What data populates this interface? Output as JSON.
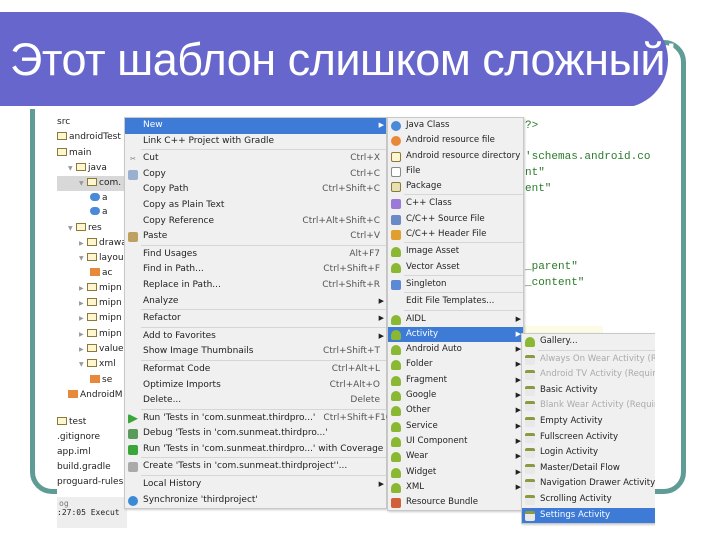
{
  "slide": {
    "title": "Этот шаблон слишком сложный!",
    "banner_color": "#6666cc",
    "frame_color": "#5f9c96"
  },
  "tree": {
    "items": [
      {
        "label": "src",
        "indent": 0,
        "icon": "none"
      },
      {
        "label": "androidTest",
        "indent": 0,
        "icon": "folder-icon"
      },
      {
        "label": "main",
        "indent": 0,
        "icon": "folder-icon"
      },
      {
        "label": "java",
        "indent": 1,
        "icon": "folder-icon",
        "open": true
      },
      {
        "label": "com.",
        "indent": 2,
        "icon": "package-icon",
        "open": true,
        "selected": true
      },
      {
        "label": "a",
        "indent": 3,
        "icon": "class-icon"
      },
      {
        "label": "a",
        "indent": 3,
        "icon": "class-icon"
      },
      {
        "label": "res",
        "indent": 1,
        "icon": "res-folder-icon",
        "open": true
      },
      {
        "label": "drawa",
        "indent": 2,
        "icon": "folder-icon",
        "closed": true
      },
      {
        "label": "layou",
        "indent": 2,
        "icon": "folder-icon",
        "open": true
      },
      {
        "label": "ac",
        "indent": 3,
        "icon": "layout-file-icon"
      },
      {
        "label": "mipn",
        "indent": 2,
        "icon": "folder-icon",
        "closed": true
      },
      {
        "label": "mipn",
        "indent": 2,
        "icon": "folder-icon",
        "closed": true
      },
      {
        "label": "mipn",
        "indent": 2,
        "icon": "folder-icon",
        "closed": true
      },
      {
        "label": "mipn",
        "indent": 2,
        "icon": "folder-icon",
        "closed": true
      },
      {
        "label": "value",
        "indent": 2,
        "icon": "folder-icon",
        "closed": true
      },
      {
        "label": "xml",
        "indent": 2,
        "icon": "folder-icon",
        "open": true
      },
      {
        "label": "se",
        "indent": 3,
        "icon": "xml-file-icon"
      },
      {
        "label": "AndroidM",
        "indent": 1,
        "icon": "manifest-icon"
      },
      {
        "label": "test",
        "indent": 0,
        "icon": "folder-icon"
      },
      {
        "label": ".gitignore",
        "indent": 0,
        "icon": "none"
      },
      {
        "label": "app.iml",
        "indent": 0,
        "icon": "none"
      },
      {
        "label": "build.gradle",
        "indent": 0,
        "icon": "none"
      },
      {
        "label": "proguard-rules.p",
        "indent": 0,
        "icon": "none"
      }
    ],
    "log_title": "og",
    "log_line": ":27:05 Execut"
  },
  "context_menu": [
    {
      "label": "New",
      "submenu": true,
      "highlight": true
    },
    {
      "label": "Link C++ Project with Gradle"
    },
    {
      "sep": true
    },
    {
      "label": "Cut",
      "shortcut": "Ctrl+X",
      "icon": "scissors-icon"
    },
    {
      "label": "Copy",
      "shortcut": "Ctrl+C",
      "icon": "copy-icon"
    },
    {
      "label": "Copy Path",
      "shortcut": "Ctrl+Shift+C"
    },
    {
      "label": "Copy as Plain Text"
    },
    {
      "label": "Copy Reference",
      "shortcut": "Ctrl+Alt+Shift+C"
    },
    {
      "label": "Paste",
      "shortcut": "Ctrl+V",
      "icon": "paste-icon"
    },
    {
      "sep": true
    },
    {
      "label": "Find Usages",
      "shortcut": "Alt+F7"
    },
    {
      "label": "Find in Path...",
      "shortcut": "Ctrl+Shift+F"
    },
    {
      "label": "Replace in Path...",
      "shortcut": "Ctrl+Shift+R"
    },
    {
      "label": "Analyze",
      "submenu": true
    },
    {
      "sep": true
    },
    {
      "label": "Refactor",
      "submenu": true
    },
    {
      "sep": true
    },
    {
      "label": "Add to Favorites",
      "submenu": true
    },
    {
      "label": "Show Image Thumbnails",
      "shortcut": "Ctrl+Shift+T"
    },
    {
      "sep": true
    },
    {
      "label": "Reformat Code",
      "shortcut": "Ctrl+Alt+L"
    },
    {
      "label": "Optimize Imports",
      "shortcut": "Ctrl+Alt+O"
    },
    {
      "label": "Delete...",
      "shortcut": "Delete"
    },
    {
      "sep": true
    },
    {
      "label": "Run 'Tests in 'com.sunmeat.thirdpro...'",
      "shortcut": "Ctrl+Shift+F10",
      "icon": "run-icon"
    },
    {
      "label": "Debug 'Tests in 'com.sunmeat.thirdpro...'",
      "icon": "debug-icon"
    },
    {
      "label": "Run 'Tests in 'com.sunmeat.thirdpro...' with Coverage",
      "icon": "coverage-icon"
    },
    {
      "sep": true
    },
    {
      "label": "Create 'Tests in 'com.sunmeat.thirdproject''...",
      "icon": "create-test-icon"
    },
    {
      "sep": true
    },
    {
      "label": "Local History",
      "submenu": true
    },
    {
      "label": "Synchronize 'thirdproject'",
      "icon": "sync-icon"
    }
  ],
  "new_submenu": [
    {
      "label": "Java Class",
      "icon": "java-class-icon"
    },
    {
      "label": "Android resource file",
      "icon": "resource-file-icon"
    },
    {
      "label": "Android resource directory",
      "icon": "folder-icon"
    },
    {
      "label": "File",
      "icon": "file-icon"
    },
    {
      "label": "Package",
      "icon": "package-icon"
    },
    {
      "sep": true
    },
    {
      "label": "C++ Class",
      "icon": "cpp-class-icon"
    },
    {
      "label": "C/C++ Source File",
      "icon": "cpp-source-icon"
    },
    {
      "label": "C/C++ Header File",
      "icon": "cpp-header-icon"
    },
    {
      "sep": true
    },
    {
      "label": "Image Asset",
      "icon": "android-icon"
    },
    {
      "label": "Vector Asset",
      "icon": "android-icon"
    },
    {
      "sep": true
    },
    {
      "label": "Singleton",
      "icon": "singleton-icon"
    },
    {
      "sep": true
    },
    {
      "label": "Edit File Templates..."
    },
    {
      "sep": true
    },
    {
      "label": "AIDL",
      "icon": "android-icon",
      "submenu": true
    },
    {
      "label": "Activity",
      "icon": "android-icon",
      "submenu": true,
      "highlight": true
    },
    {
      "label": "Android Auto",
      "icon": "android-icon",
      "submenu": true
    },
    {
      "label": "Folder",
      "icon": "android-icon",
      "submenu": true
    },
    {
      "label": "Fragment",
      "icon": "android-icon",
      "submenu": true
    },
    {
      "label": "Google",
      "icon": "android-icon",
      "submenu": true
    },
    {
      "label": "Other",
      "icon": "android-icon",
      "submenu": true
    },
    {
      "label": "Service",
      "icon": "android-icon",
      "submenu": true
    },
    {
      "label": "UI Component",
      "icon": "android-icon",
      "submenu": true
    },
    {
      "label": "Wear",
      "icon": "android-icon",
      "submenu": true
    },
    {
      "label": "Widget",
      "icon": "android-icon",
      "submenu": true
    },
    {
      "label": "XML",
      "icon": "android-icon",
      "submenu": true
    },
    {
      "label": "Resource Bundle",
      "icon": "resource-bundle-icon"
    }
  ],
  "activity_submenu": [
    {
      "label": "Gallery...",
      "icon": "android-icon"
    },
    {
      "sep": true
    },
    {
      "label": "Always On Wear Activity (Req",
      "icon": "template-icon",
      "disabled": true
    },
    {
      "label": "Android TV Activity (Requires",
      "icon": "template-icon",
      "disabled": true
    },
    {
      "label": "Basic Activity",
      "icon": "template-icon"
    },
    {
      "label": "Blank Wear Activity (Requires",
      "icon": "template-icon",
      "disabled": true
    },
    {
      "label": "Empty Activity",
      "icon": "template-icon"
    },
    {
      "label": "Fullscreen Activity",
      "icon": "template-icon"
    },
    {
      "label": "Login Activity",
      "icon": "template-icon"
    },
    {
      "label": "Master/Detail Flow",
      "icon": "template-icon"
    },
    {
      "label": "Navigation Drawer Activity",
      "icon": "template-icon"
    },
    {
      "label": "Scrolling Activity",
      "icon": "template-icon"
    },
    {
      "label": "Settings Activity",
      "icon": "template-icon",
      "highlight": true
    }
  ],
  "code_lines": [
    {
      "text": "?>",
      "line": 1
    },
    {
      "text": "'schemas.android.co",
      "line": 3
    },
    {
      "text": "nt\"",
      "line": 4
    },
    {
      "text": "ent\"",
      "line": 5
    },
    {
      "text": "_parent\"",
      "line": 10
    },
    {
      "text": "_content\"",
      "line": 11
    }
  ],
  "colors": {
    "highlight": "#3d7bd6",
    "code": "#2a7a2a",
    "android": "#8bb832"
  }
}
